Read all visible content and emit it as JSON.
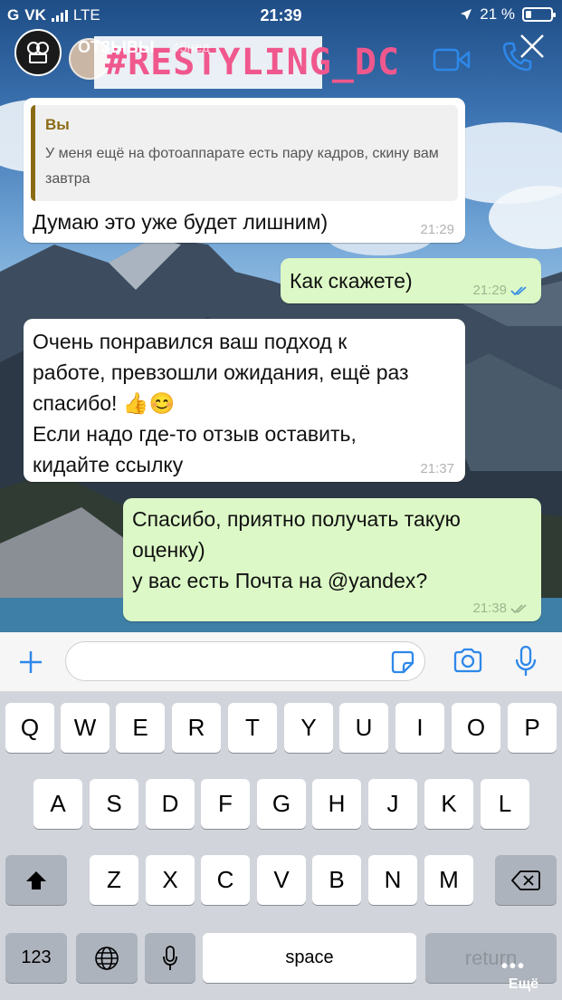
{
  "status_bar": {
    "carrier": "VK",
    "network": "LTE",
    "time": "21:39",
    "battery": "21 %"
  },
  "story": {
    "account_name": "ОТЗЫВЫ",
    "posted_ago": "45нед",
    "sticker_text": "#RESTYLING_DC"
  },
  "messages": [
    {
      "direction": "incoming",
      "quote_author": "Вы",
      "quote_text": "У меня ещё на фотоаппарате есть пару кадров, скину вам завтра",
      "text": "Думаю это уже будет лишним)",
      "time": "21:29"
    },
    {
      "direction": "outgoing",
      "text": "Как скажете)",
      "time": "21:29",
      "read": true
    },
    {
      "direction": "incoming",
      "lines": [
        "Очень понравился ваш подход к",
        "работе, превзошли ожидания, ещё раз",
        "спасибо! 👍😊",
        "Если надо где-то отзыв оставить,",
        "кидайте ссылку"
      ],
      "time": "21:37"
    },
    {
      "direction": "outgoing",
      "lines": [
        "Спасибо, приятно получать такую",
        "оценку)",
        "у вас есть Почта на @yandex?"
      ],
      "time": "21:38",
      "read": false
    }
  ],
  "input": {
    "value": "",
    "placeholder": ""
  },
  "keyboard": {
    "row1": [
      "Q",
      "W",
      "E",
      "R",
      "T",
      "Y",
      "U",
      "I",
      "O",
      "P"
    ],
    "row2": [
      "A",
      "S",
      "D",
      "F",
      "G",
      "H",
      "J",
      "K",
      "L"
    ],
    "row3": [
      "Z",
      "X",
      "C",
      "V",
      "B",
      "N",
      "M"
    ],
    "numbers_key": "123",
    "space_key": "space",
    "return_key": "return"
  },
  "story_more": "Ещё",
  "colors": {
    "incoming_bubble": "#ffffff",
    "outgoing_bubble": "#dcf8c6",
    "accent_blue": "#2e88ea",
    "quote_accent": "#8b6b16",
    "sticker_pink": "#f0588d"
  }
}
